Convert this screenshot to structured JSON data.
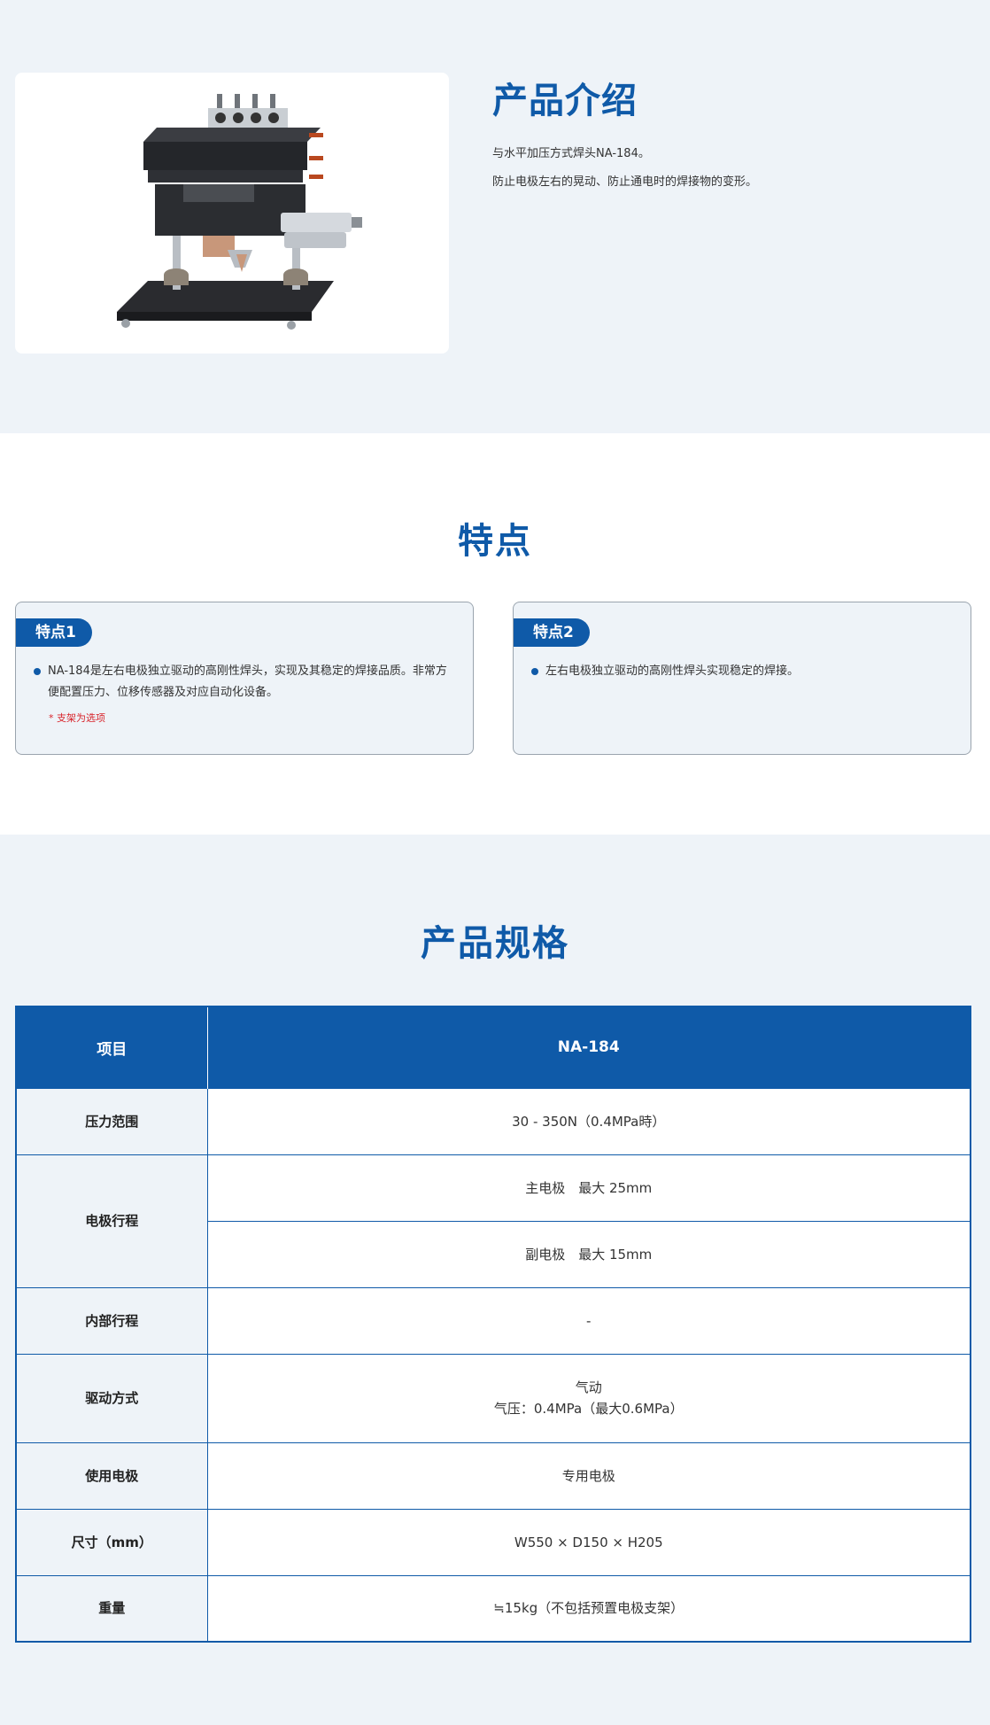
{
  "intro": {
    "title": "产品介绍",
    "lines": [
      "与水平加压方式焊头NA-184。",
      "防止电极左右的晃动、防止通电时的焊接物的变形。"
    ]
  },
  "features": {
    "title": "特点",
    "cards": [
      {
        "badge": "特点1",
        "text": "NA-184是左右电极独立驱动的高刚性焊头，实现及其稳定的焊接品质。非常方便配置压力、位移传感器及对应自动化设备。",
        "note": "* 支架为选项"
      },
      {
        "badge": "特点2",
        "text": "左右电极独立驱动的高刚性焊头实现稳定的焊接。"
      }
    ]
  },
  "specs": {
    "title": "产品规格",
    "header": {
      "item": "项目",
      "model": "NA-184"
    },
    "rows": {
      "pressure": {
        "label": "压力范围",
        "value": "30 - 350N（0.4MPa時）"
      },
      "stroke": {
        "label": "电极行程",
        "main": "主电极　最大 25mm",
        "sub": "副电极　最大 15mm"
      },
      "internal": {
        "label": "内部行程",
        "value": "-"
      },
      "drive": {
        "label": "驱动方式",
        "line1": "气动",
        "line2": "气压：0.4MPa（最大0.6MPa）"
      },
      "electrode": {
        "label": "使用电极",
        "value": "专用电极"
      },
      "size": {
        "label": "尺寸（mm）",
        "value": "W550 × D150 × H205"
      },
      "weight": {
        "label": "重量",
        "value": "≒15kg（不包括预置电极支架）"
      }
    }
  },
  "colors": {
    "brand_blue": "#0f5aa8",
    "section_bg": "#eef3f8",
    "note_red": "#d8242b"
  }
}
